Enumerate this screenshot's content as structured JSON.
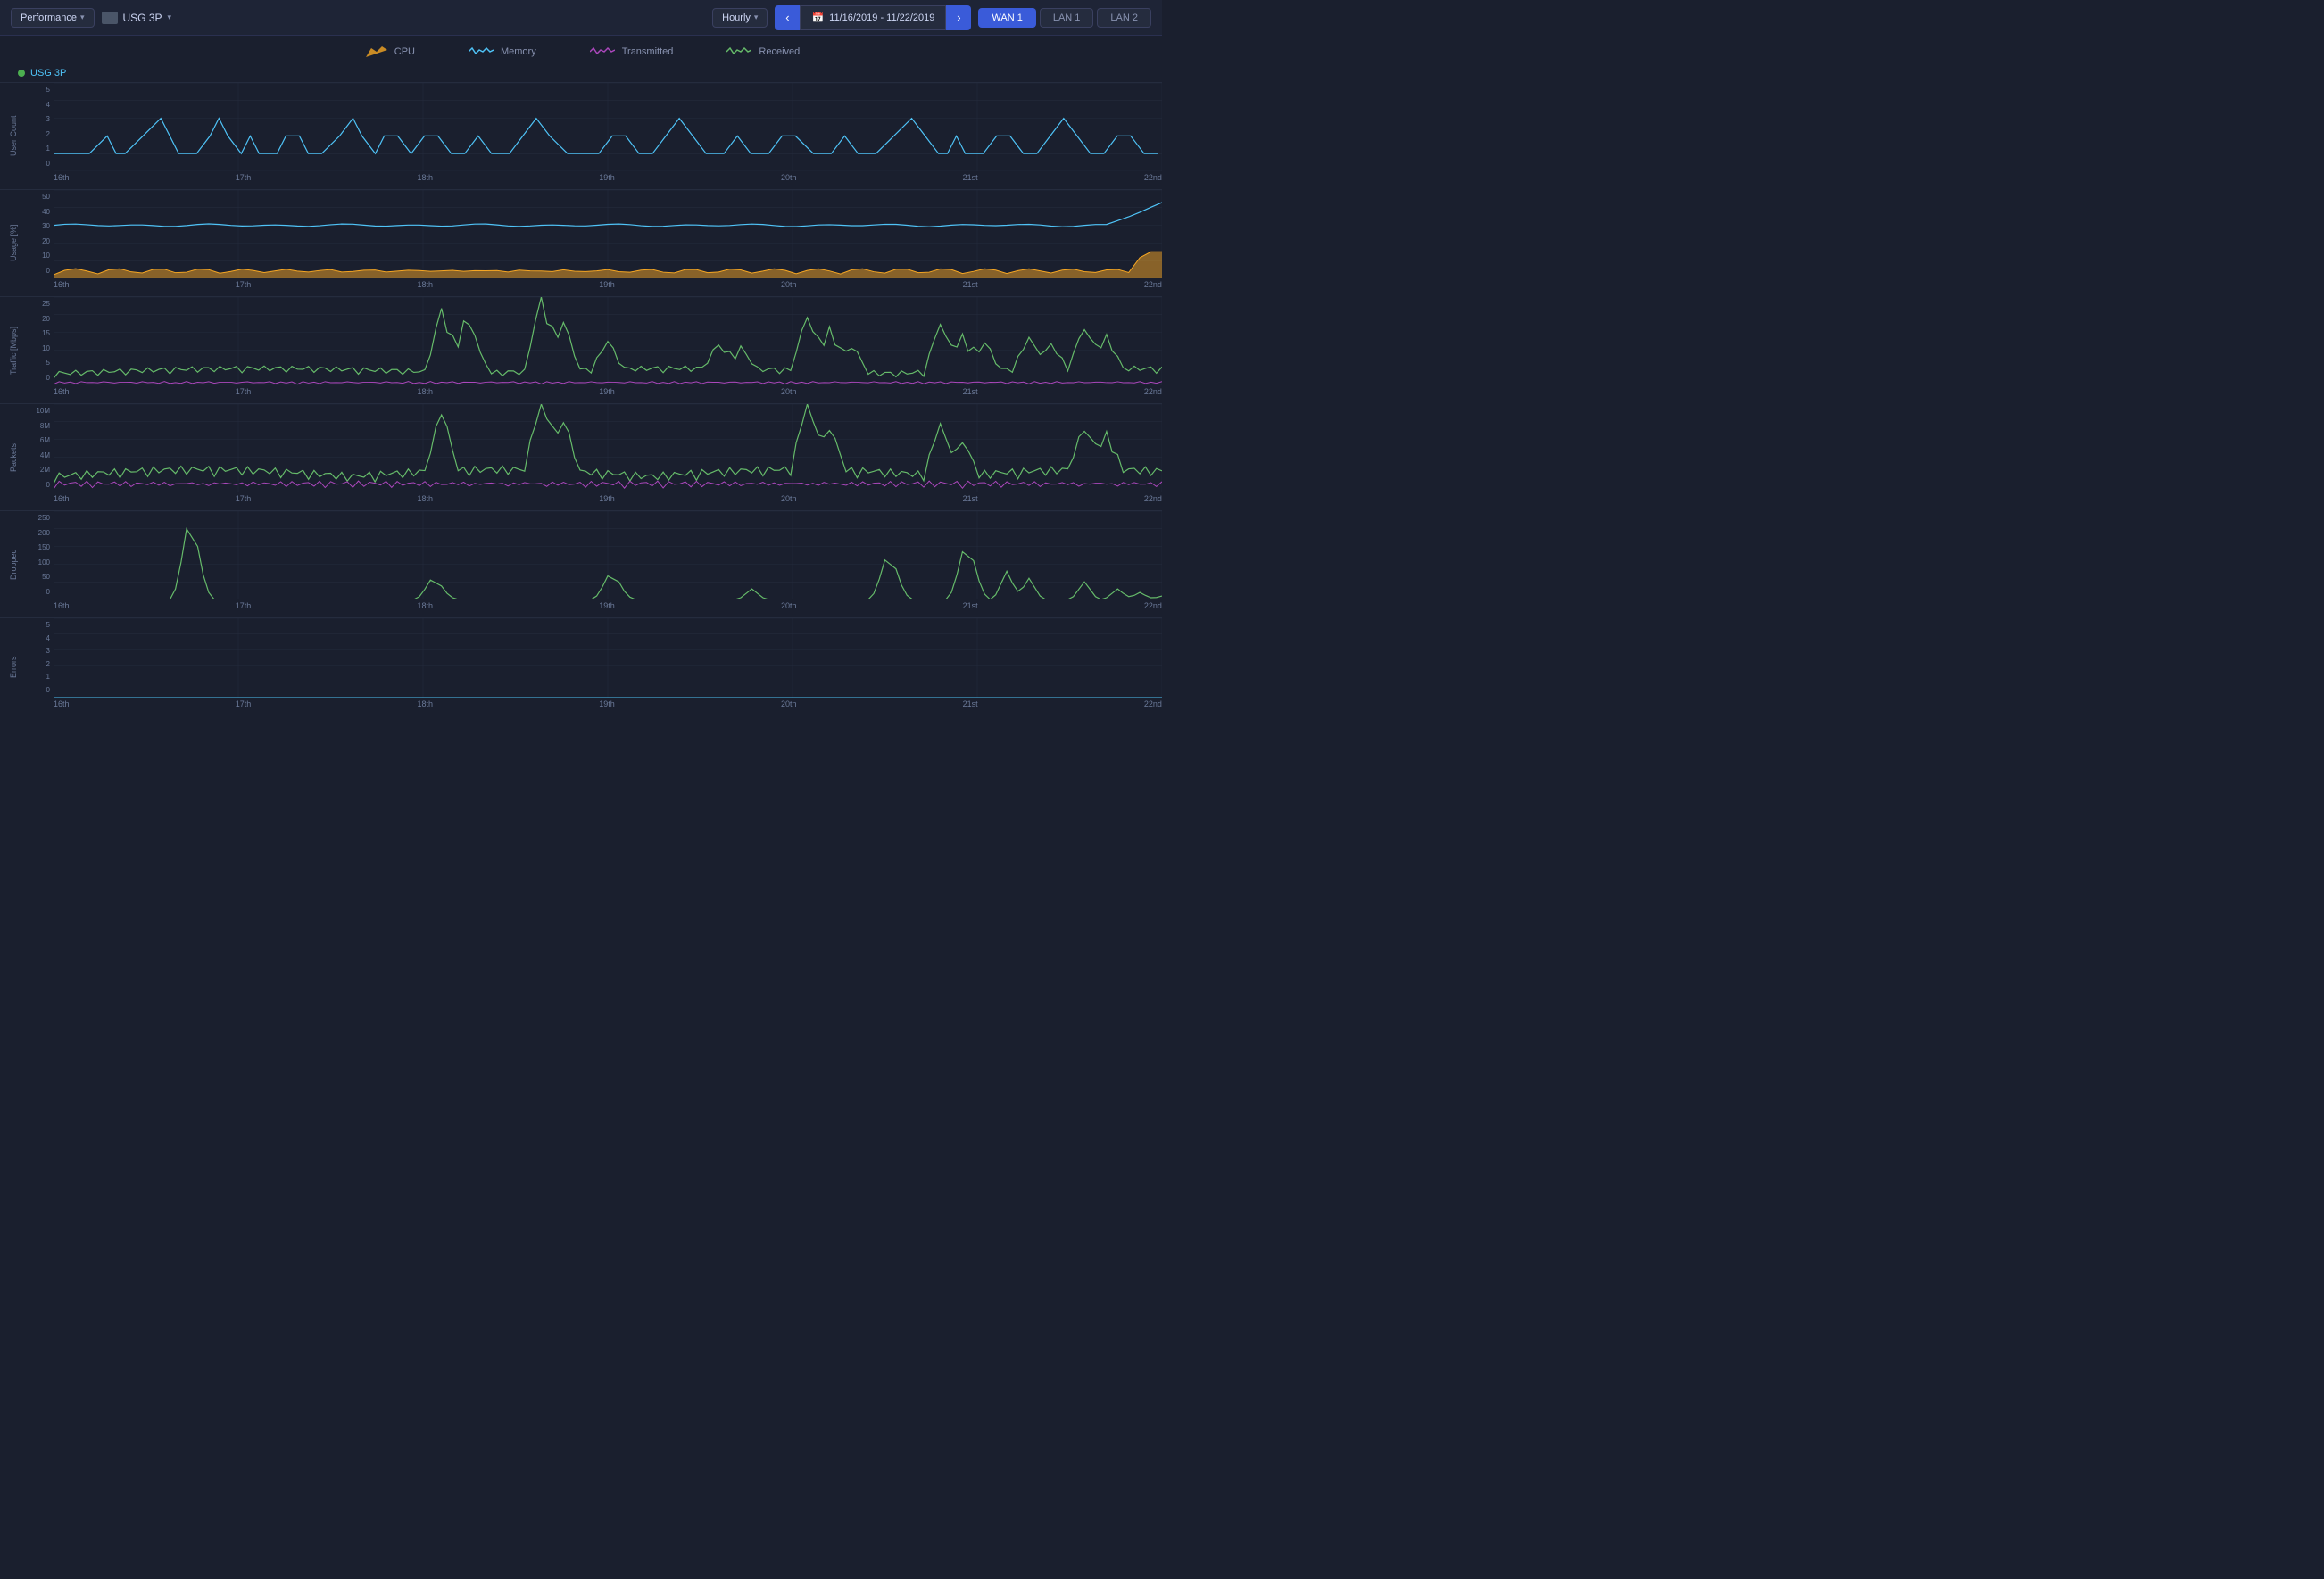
{
  "topbar": {
    "performance_label": "Performance",
    "device_label": "USG 3P",
    "hourly_label": "Hourly",
    "date_range": "11/16/2019 - 11/22/2019",
    "nav_prev": "‹",
    "nav_next": "›",
    "calendar_icon": "📅",
    "interfaces": [
      "WAN 1",
      "LAN 1",
      "LAN 2"
    ],
    "active_interface": "WAN 1"
  },
  "legend": {
    "items": [
      {
        "label": "CPU",
        "color": "#f5a623",
        "icon": "mountain"
      },
      {
        "label": "Memory",
        "color": "#4fc3f7",
        "icon": "wave"
      },
      {
        "label": "Transmitted",
        "color": "#ab47bc",
        "icon": "wave2"
      },
      {
        "label": "Received",
        "color": "#66bb6a",
        "icon": "wave3"
      }
    ]
  },
  "device": {
    "dot_color": "#4caf50",
    "name": "USG 3P"
  },
  "x_labels": [
    "16th",
    "17th",
    "18th",
    "19th",
    "20th",
    "21st",
    "22nd"
  ],
  "charts": [
    {
      "id": "user-count",
      "y_label": "User Count",
      "y_ticks": [
        "5",
        "4",
        "3",
        "2",
        "1",
        "0"
      ],
      "height": 120
    },
    {
      "id": "usage",
      "y_label": "Usage [%]",
      "y_ticks": [
        "50",
        "40",
        "30",
        "20",
        "10",
        "0"
      ],
      "height": 120
    },
    {
      "id": "traffic",
      "y_label": "Traffic [Mbps]",
      "y_ticks": [
        "25",
        "20",
        "15",
        "10",
        "5",
        "0"
      ],
      "height": 120
    },
    {
      "id": "packets",
      "y_label": "Packets",
      "y_ticks": [
        "10M",
        "8M",
        "6M",
        "4M",
        "2M",
        "0"
      ],
      "height": 120
    },
    {
      "id": "dropped",
      "y_label": "Dropped",
      "y_ticks": [
        "250",
        "200",
        "150",
        "100",
        "50",
        "0"
      ],
      "height": 120
    },
    {
      "id": "errors",
      "y_label": "Errors",
      "y_ticks": [
        "5",
        "4",
        "3",
        "2",
        "1",
        "0"
      ],
      "height": 110
    }
  ],
  "colors": {
    "bg": "#1a1f2e",
    "panel": "#1e2436",
    "border": "#2a3050",
    "blue_line": "#4fc3f7",
    "green_line": "#66bb6a",
    "purple_line": "#ab47bc",
    "gold_fill": "#f5a623",
    "grid": "#252c3e",
    "accent": "#3a5bd9",
    "green_dot": "#4caf50"
  }
}
